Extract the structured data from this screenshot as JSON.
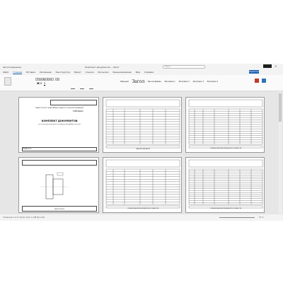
{
  "window": {
    "title": "Комплект документов — Word",
    "autosave_label": "Автосохранение",
    "search_placeholder": "Поиск",
    "share_label": "Поделиться"
  },
  "menu": {
    "tabs": [
      "Файл",
      "Главная",
      "Вставка",
      "Рисование",
      "Конструктор",
      "Макет",
      "Ссылки",
      "Рассылки",
      "Рецензирование",
      "Вид",
      "Справка"
    ],
    "active_tab": "Главная"
  },
  "ribbon": {
    "font_name": "Times New Roman",
    "font_size": "10",
    "styles": [
      "Обычный",
      "Без интервала",
      "Заголовок 1",
      "Заголовок 2",
      "Заголовок 3",
      "Заголовок 4"
    ],
    "style_large_label": "Загол"
  },
  "doc": {
    "page1": {
      "header": "МИНИСТЕРСТВО ОБРАЗОВАНИЯ И НАУКИ РОССИЙСКОЙ ФЕДЕРАЦИИ",
      "approve": "УТВЕРЖДАЮ",
      "title": "КОМПЛЕКТ ДОКУМЕНТОВ",
      "subtitle": "на технологический процесс механической обработки детали",
      "bottom_label": "Разработал"
    },
    "page2": {
      "footer": "МАРШРУТНАЯ КАРТА"
    },
    "page3": {
      "footer": "ОПЕРАЦИОННАЯ КАРТА МЕХАНИЧЕСКОЙ ОБРАБОТКИ"
    },
    "page4": {
      "footer": "КАРТА ЭСКИЗОВ"
    },
    "page5": {
      "footer": "ОПЕРАЦИОННАЯ КАРТА МЕХАНИЧЕСКОЙ ОБРАБОТКИ"
    },
    "page6": {
      "footer": "ОПЕРАЦИОННАЯ КАРТА МЕХАНИЧЕСКОЙ ОБРАБОТКИ"
    }
  },
  "status": {
    "left": "Страница 1 из 6   Число слов: 1 248   Русский",
    "zoom": "37 %"
  }
}
